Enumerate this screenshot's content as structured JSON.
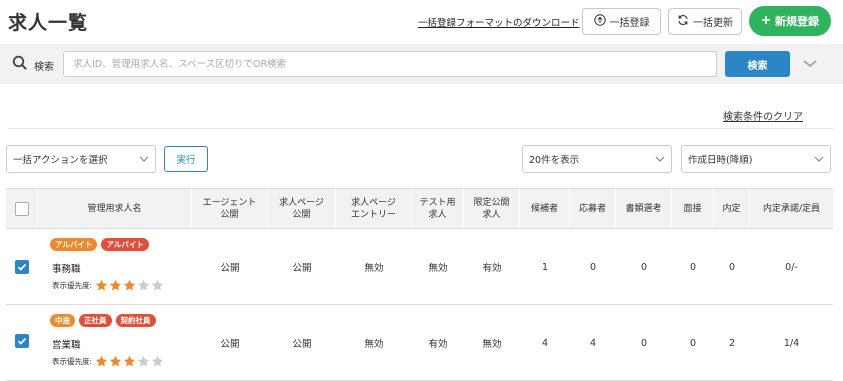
{
  "header": {
    "title": "求人一覧",
    "download_link": "一括登録フォーマットのダウンロード",
    "bulk_register": "一括登録",
    "bulk_update": "一括更新",
    "new_register": "新規登録"
  },
  "search": {
    "label": "検索",
    "placeholder": "求人ID、管理用求人名、スペース区切りでOR検索",
    "value": "",
    "button": "検索"
  },
  "clear_conditions": "検索条件のクリア",
  "controls": {
    "bulk_action": "一括アクションを選択",
    "execute": "実行",
    "per_page": "20件を表示",
    "sort": "作成日時(降順)"
  },
  "table": {
    "columns": [
      "管理用求人名",
      "エージェント\n公開",
      "求人ページ\n公開",
      "求人ページ\nエントリー",
      "テスト用\n求人",
      "限定公開\n求人",
      "候補者",
      "応募者",
      "書類選考",
      "面接",
      "内定",
      "内定承諾/定員"
    ],
    "priority_label": "表示優先度:",
    "rows": [
      {
        "badges": [
          {
            "text": "アルバイト",
            "color": "#ef8a2a"
          },
          {
            "text": "アルバイト",
            "color": "#e14e3a"
          }
        ],
        "name": "事務職",
        "stars": 3,
        "max_stars": 5,
        "checked": true,
        "cells": [
          "公開",
          "公開",
          "無効",
          "無効",
          "有効",
          "1",
          "0",
          "0",
          "0",
          "0",
          "0/-"
        ]
      },
      {
        "badges": [
          {
            "text": "中途",
            "color": "#ef8a2a"
          },
          {
            "text": "正社員",
            "color": "#e14e3a"
          },
          {
            "text": "契約社員",
            "color": "#e14e3a"
          }
        ],
        "name": "営業職",
        "stars": 3,
        "max_stars": 5,
        "checked": true,
        "cells": [
          "公開",
          "公開",
          "無効",
          "有効",
          "無効",
          "4",
          "4",
          "0",
          "0",
          "2",
          "1/4"
        ]
      }
    ]
  },
  "colors": {
    "primary": "#2a86c4",
    "new_button": "#2fb35e",
    "star_on": "#ef8a2a",
    "star_off": "#cccccc"
  }
}
